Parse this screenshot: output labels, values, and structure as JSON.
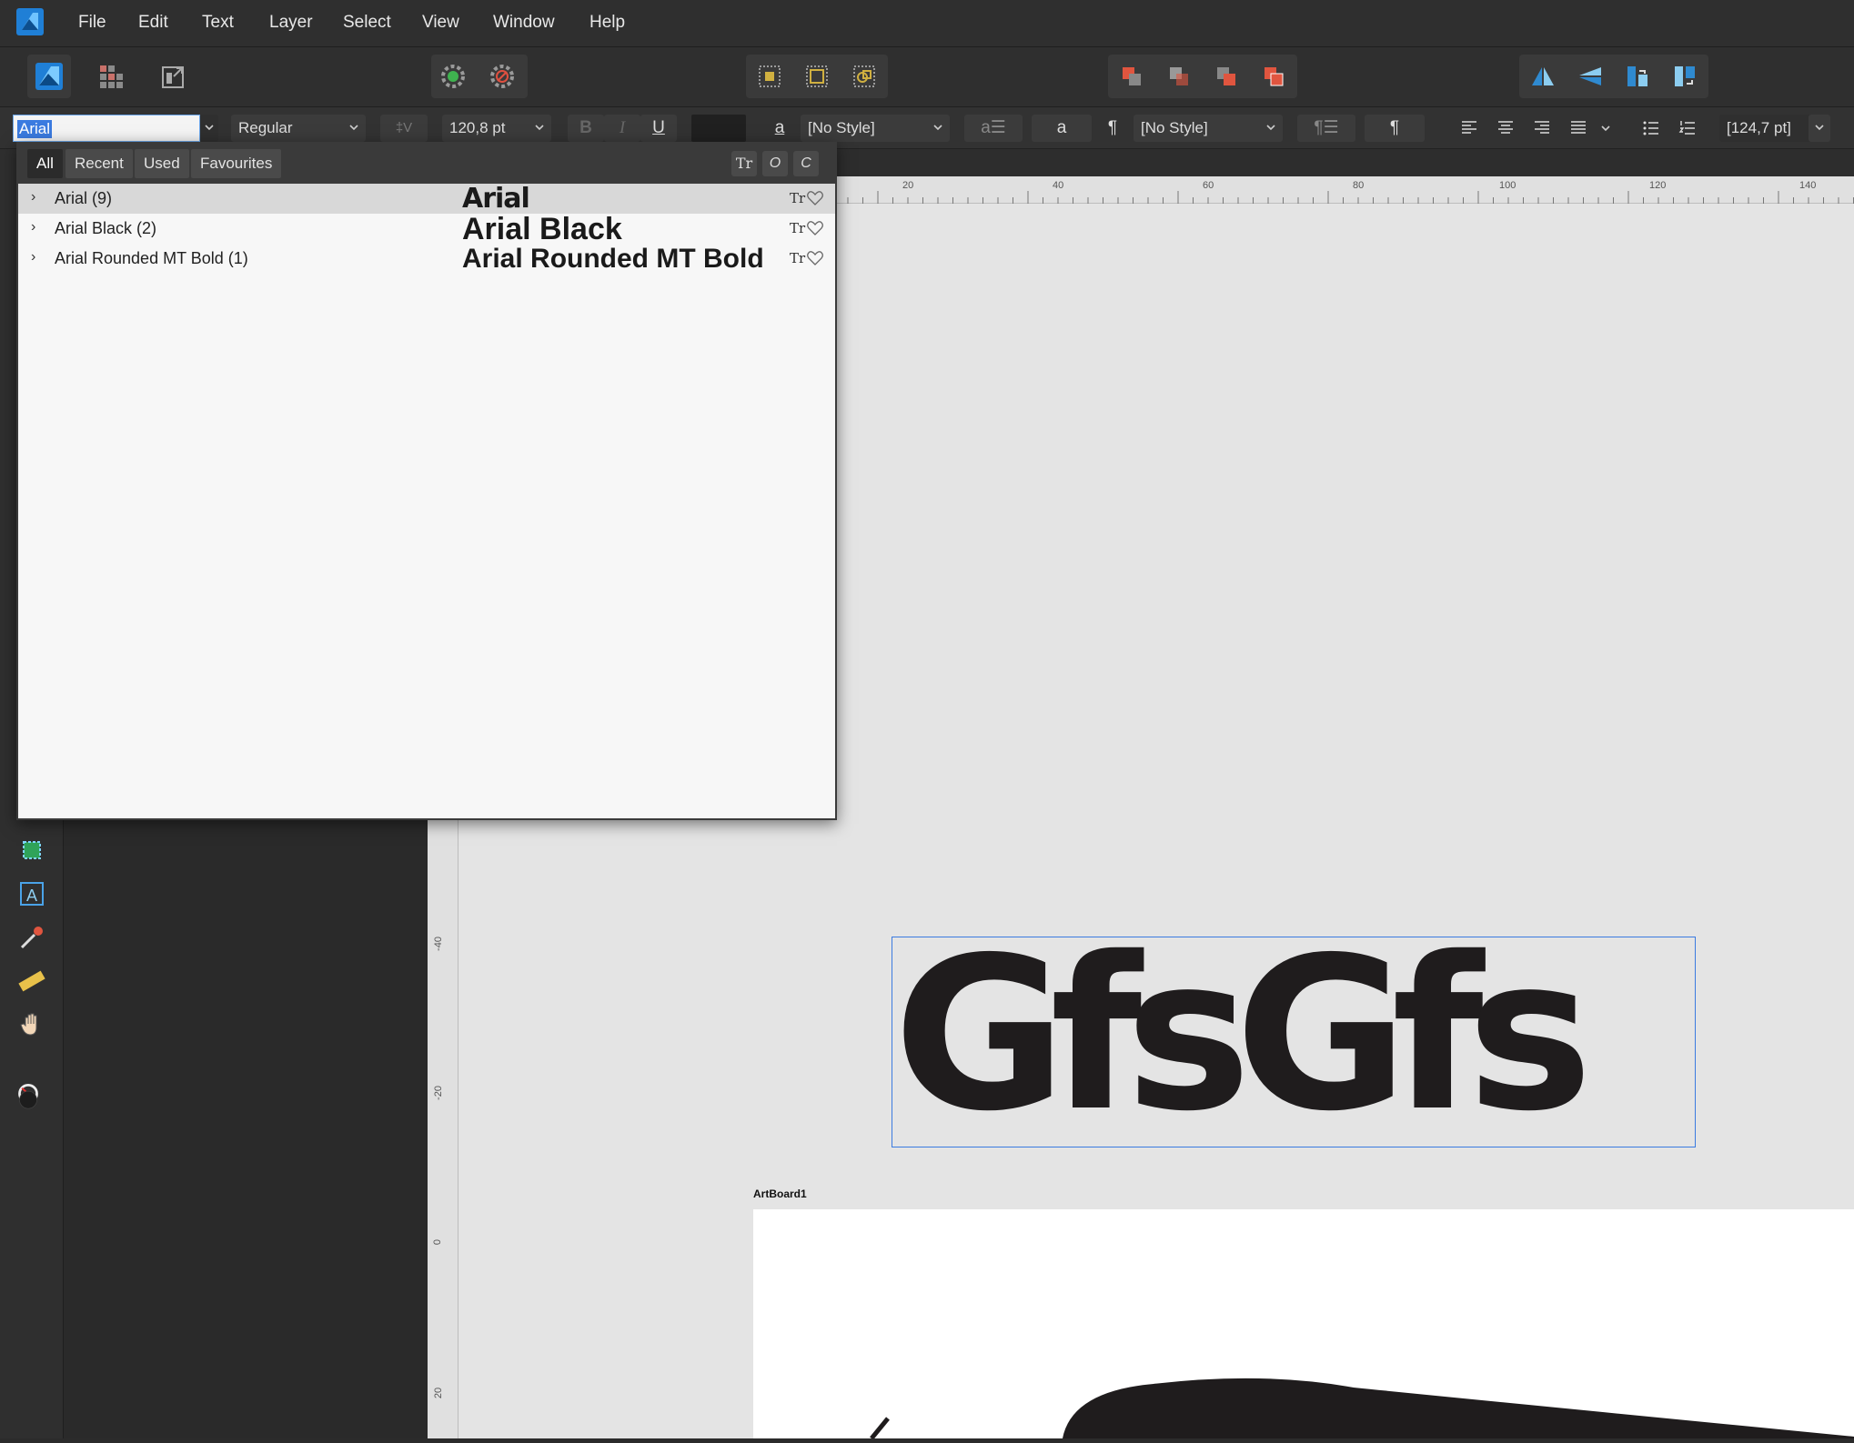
{
  "menubar": {
    "items": [
      "File",
      "Edit",
      "Text",
      "Layer",
      "Select",
      "View",
      "Window",
      "Help"
    ]
  },
  "contextbar": {
    "font_name": "Arial",
    "font_style": "Regular",
    "font_size": "120,8 pt",
    "bold": "B",
    "italic": "I",
    "underline": "U",
    "char_style_glyph": "a",
    "char_style": "[No Style]",
    "para_style_glyph": "¶",
    "para_style": "[No Style]",
    "leading": "[124,7 pt]"
  },
  "font_popup": {
    "tabs": [
      "All",
      "Recent",
      "Used",
      "Favourites"
    ],
    "active_tab": "All",
    "icon_tt": "Tr",
    "icon_o": "O",
    "icon_c": "C",
    "fonts": [
      {
        "name": "Arial (9)",
        "preview": "Arial"
      },
      {
        "name": "Arial Black (2)",
        "preview": "Arial Black"
      },
      {
        "name": "Arial Rounded MT Bold (1)",
        "preview": "Arial Rounded MT Bold"
      }
    ]
  },
  "rulers": {
    "horizontal": [
      "20",
      "40",
      "60",
      "80",
      "100",
      "120",
      "140"
    ],
    "vertical": [
      "-40",
      "-20",
      "0",
      "20"
    ]
  },
  "canvas": {
    "text": "GfsGfs",
    "artboard_label": "ArtBoard1"
  },
  "colors": {
    "accent": "#3b7be0",
    "text_fill": "#1f1c1d"
  }
}
